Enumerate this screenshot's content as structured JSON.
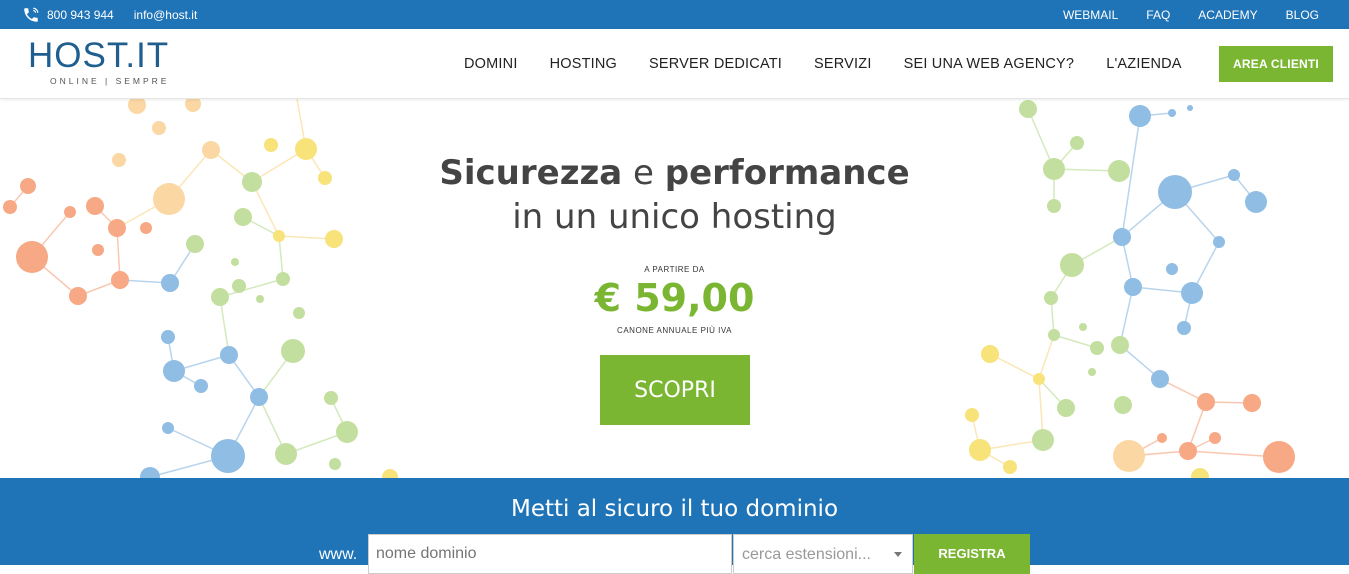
{
  "topbar": {
    "phone": "800 943 944",
    "email": "info@host.it",
    "links": [
      "WEBMAIL",
      "FAQ",
      "ACADEMY",
      "BLOG"
    ]
  },
  "logo": {
    "name": "HOST.IT",
    "tagline": "ONLINE | SEMPRE"
  },
  "nav": {
    "items": [
      "DOMINI",
      "HOSTING",
      "SERVER DEDICATI",
      "SERVIZI",
      "SEI UNA WEB AGENCY?",
      "L'AZIENDA"
    ],
    "cta": "AREA CLIENTI"
  },
  "hero": {
    "headline_bold_1": "Sicurezza",
    "headline_mid": " e ",
    "headline_bold_2": "performance",
    "headline_line2": "in un unico hosting",
    "prefix": "A PARTIRE DA",
    "price": "€ 59,00",
    "note": "CANONE ANNUALE PIÙ IVA",
    "button": "SCOPRI"
  },
  "domain_search": {
    "title": "Metti al sicuro il tuo dominio",
    "prefix": "www.",
    "input_placeholder": "nome dominio",
    "select_placeholder": "cerca estensioni...",
    "button": "REGISTRA"
  },
  "colors": {
    "brand_blue": "#1f73b7",
    "accent_green": "#7ab632",
    "text_dark": "#444444"
  },
  "icons": {
    "phone": "phone-icon",
    "dropdown": "chevron-down-icon",
    "decoration": "molecule-network"
  }
}
